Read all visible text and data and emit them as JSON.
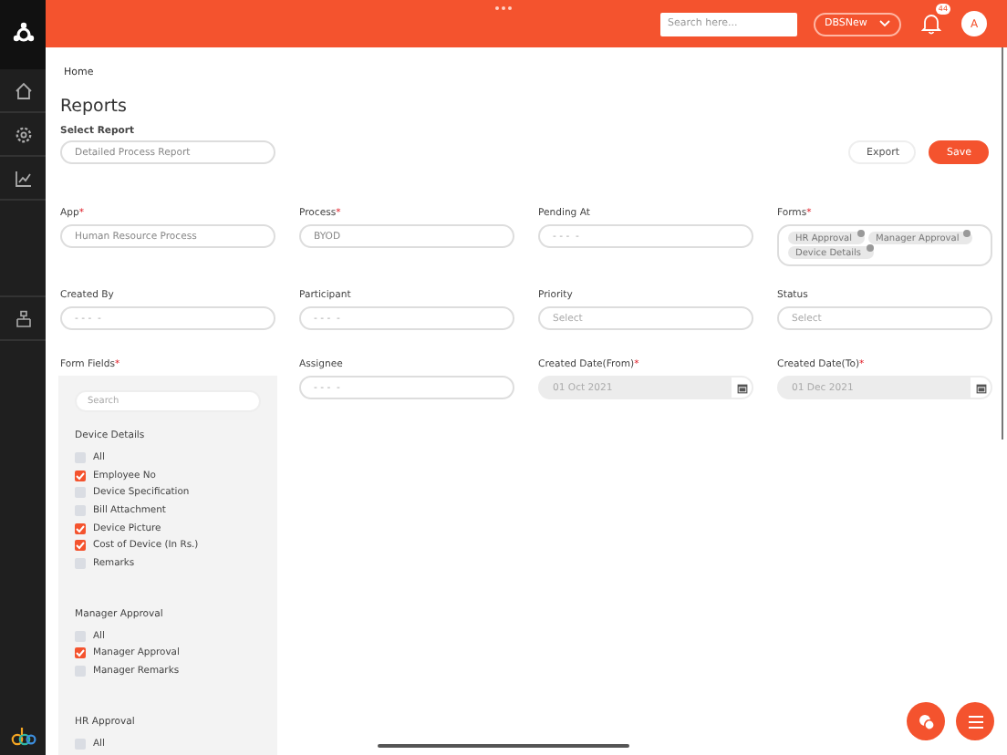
{
  "top_bar": {
    "search": {
      "placeholder": "Search here..."
    },
    "workspace": "DBSNew",
    "notification_count": "44",
    "avatar_initial": "A"
  },
  "breadcrumb": [
    "Home"
  ],
  "title": "Reports",
  "select_report": {
    "label": "Select Report",
    "value": "Detailed Process Report"
  },
  "actions": [
    {
      "label": "Export",
      "kind": "secondary"
    },
    {
      "label": "Save",
      "kind": "primary"
    }
  ],
  "filters": [
    {
      "label": "App",
      "required_mark": "*",
      "kind": "text",
      "value": "Human Resource Process"
    },
    {
      "label": "Process",
      "required_mark": "*",
      "kind": "text",
      "value": "BYOD"
    },
    {
      "label": "Pending At",
      "kind": "text",
      "placeholder": "- - -  -"
    },
    {
      "label": "Forms",
      "required_mark": "*",
      "kind": "tags",
      "tags": [
        "HR Approval",
        "Manager Approval",
        "Device Details"
      ]
    },
    {
      "label": "Created By",
      "kind": "text",
      "placeholder": "- - -  -"
    },
    {
      "label": "Participant",
      "kind": "text",
      "placeholder": "- - -  -"
    },
    {
      "label": "Priority",
      "kind": "text",
      "placeholder": "Select"
    },
    {
      "label": "Status",
      "kind": "text",
      "placeholder": "Select"
    },
    {
      "label": "Form Fields",
      "required_mark": "*",
      "kind": "fields",
      "search": {
        "placeholder": "Search"
      },
      "groups": [
        {
          "title": "Device Details",
          "items": [
            {
              "label": "All",
              "checked": false
            },
            {
              "label": "Employee No",
              "checked": true
            },
            {
              "label": "Device Specification",
              "checked": false
            },
            {
              "label": "Bill Attachment",
              "checked": false
            },
            {
              "label": "Device Picture",
              "checked": true
            },
            {
              "label": "Cost of Device (In Rs.)",
              "checked": true
            },
            {
              "label": "Remarks",
              "checked": false
            }
          ]
        },
        {
          "title": "Manager Approval",
          "items": [
            {
              "label": "All",
              "checked": false
            },
            {
              "label": "Manager Approval",
              "checked": true
            },
            {
              "label": "Manager Remarks",
              "checked": false
            }
          ]
        },
        {
          "title": "HR Approval",
          "items": [
            {
              "label": "All",
              "checked": false
            }
          ]
        }
      ]
    },
    {
      "label": "Assignee",
      "kind": "text",
      "placeholder": "- - -  -"
    },
    {
      "label": "Created Date(From)",
      "required_mark": "*",
      "kind": "date",
      "value": "01 Oct 2021"
    },
    {
      "label": "Created Date(To)",
      "required_mark": "*",
      "kind": "date",
      "value": "01 Dec 2021"
    }
  ]
}
